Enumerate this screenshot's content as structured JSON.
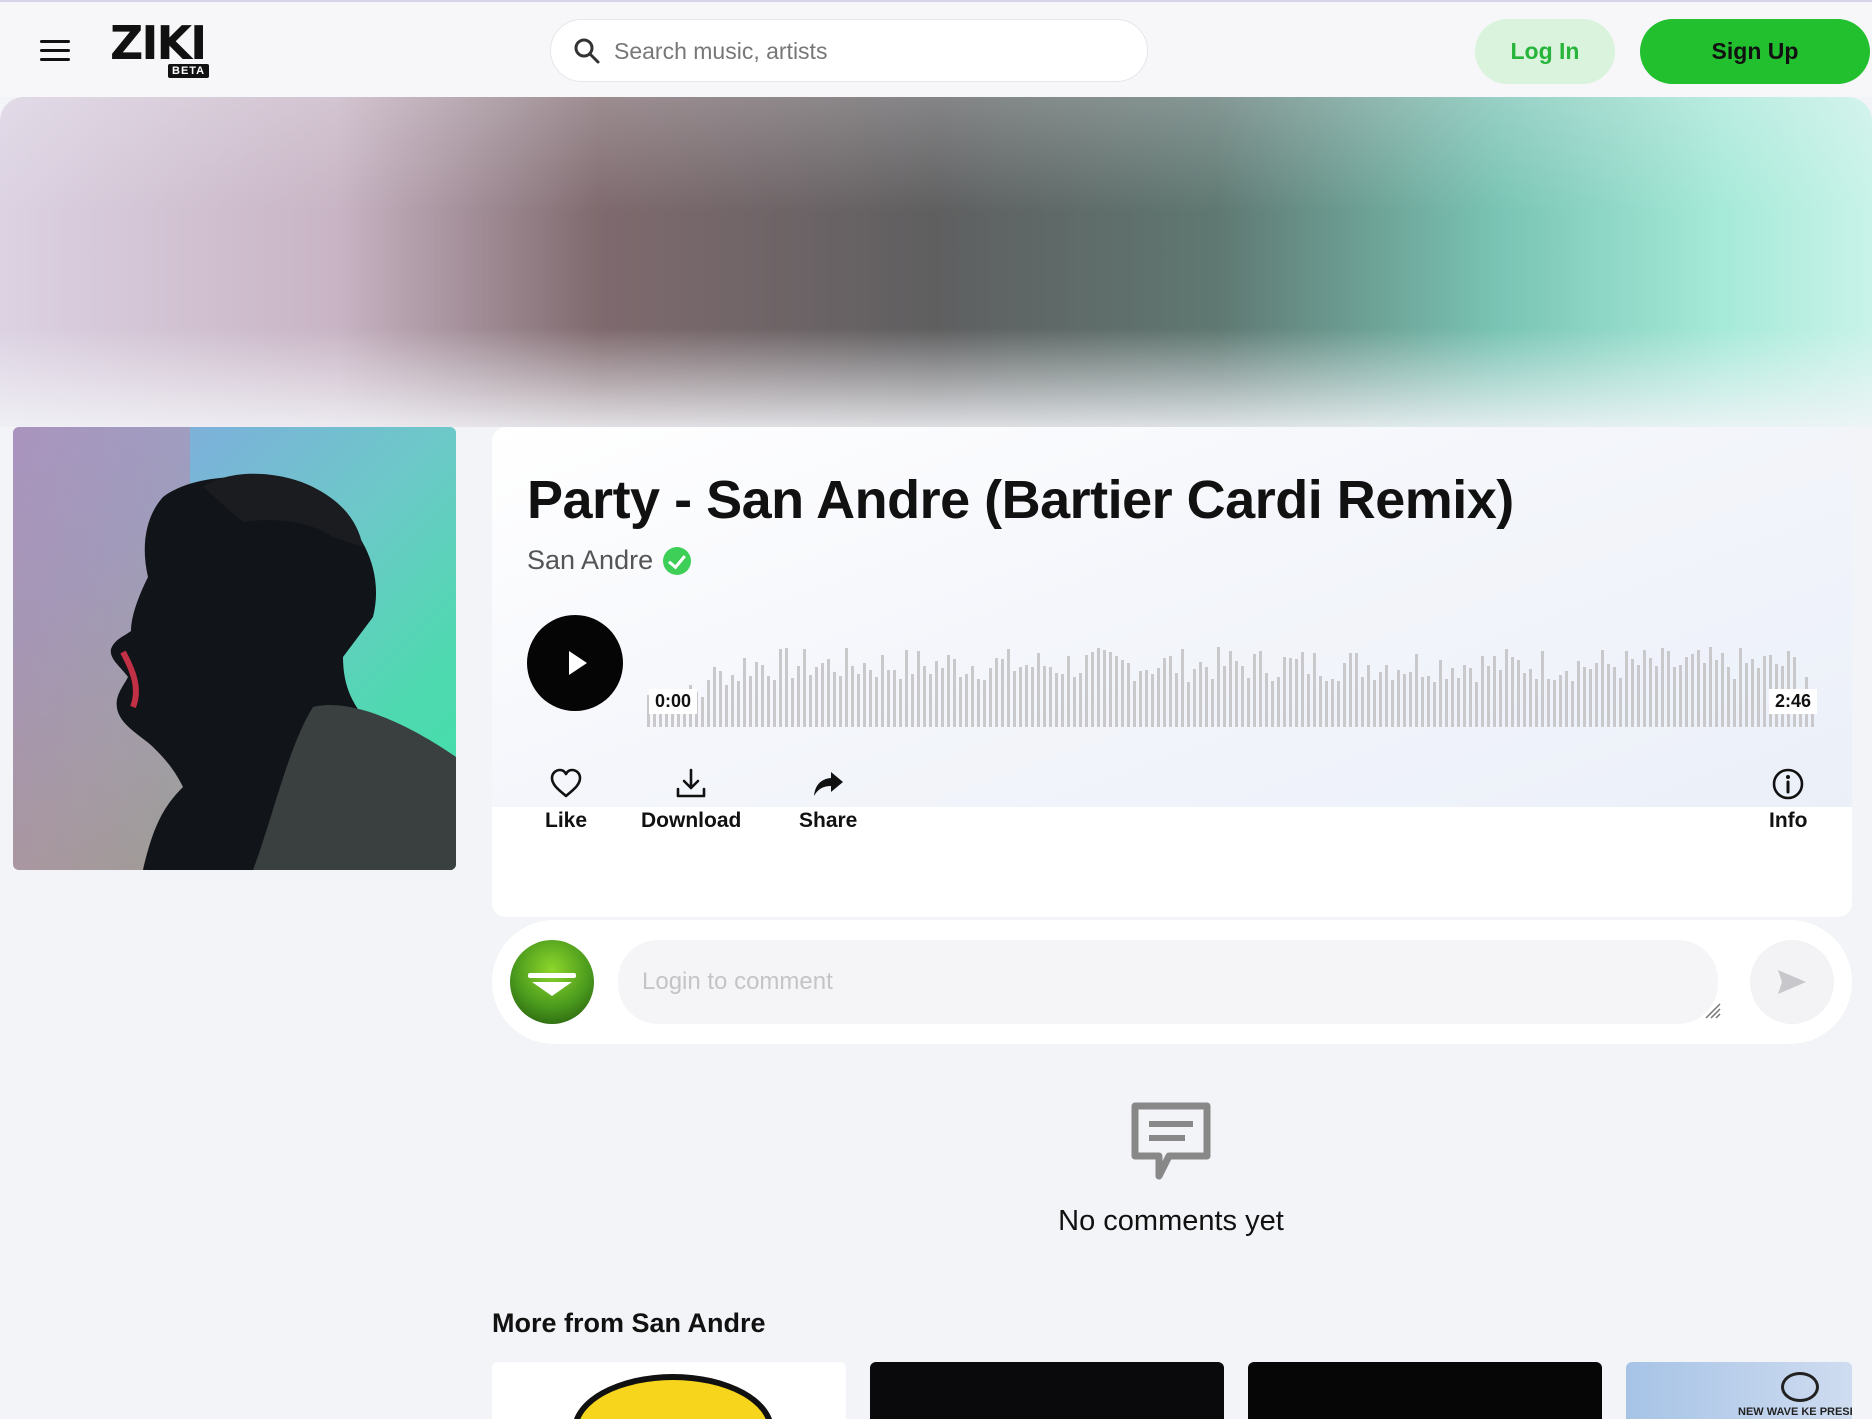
{
  "header": {
    "logo_text": "ZIKI",
    "logo_badge": "BETA",
    "search_placeholder": "Search music, artists",
    "login_label": "Log In",
    "signup_label": "Sign Up"
  },
  "track": {
    "title": "Party - San Andre (Bartier Cardi Remix)",
    "artist": "San Andre",
    "time_current": "0:00",
    "time_total": "2:46",
    "progress": 0
  },
  "actions": {
    "like": "Like",
    "download": "Download",
    "share": "Share",
    "info": "Info"
  },
  "comments": {
    "input_placeholder": "Login to comment",
    "empty_text": "No comments yet"
  },
  "more": {
    "title": "More from San Andre",
    "tile4_caption": "NEW WAVE KE PRESEI"
  },
  "colors": {
    "brand_green": "#22bf2f",
    "login_bg": "#d9f3dc",
    "verified_green": "#3ecf58",
    "waveform_gray": "#c9c9cc"
  },
  "icons": [
    "menu-icon",
    "search-icon",
    "verified-icon",
    "play-icon",
    "heart-icon",
    "download-icon",
    "share-icon",
    "info-icon",
    "send-icon",
    "comment-icon"
  ]
}
